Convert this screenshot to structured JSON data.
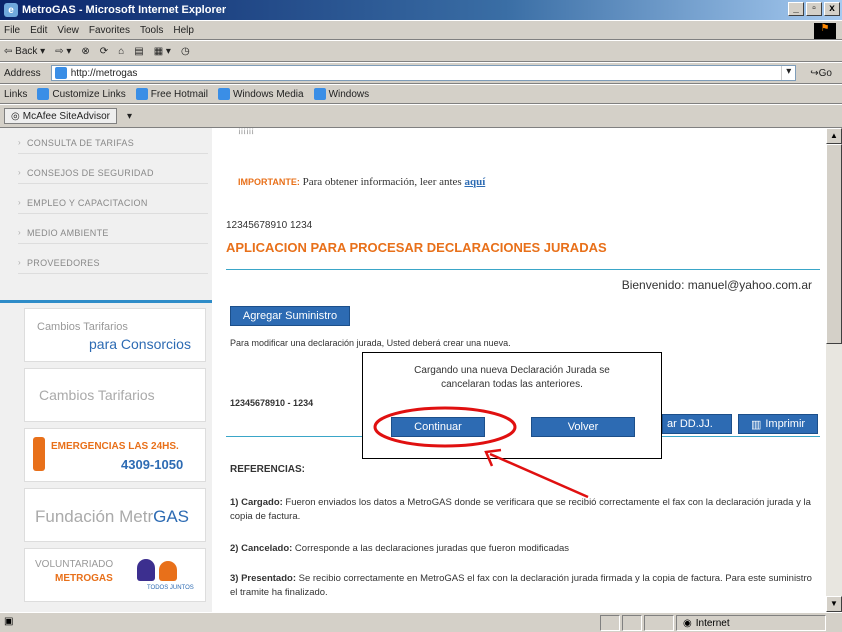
{
  "window": {
    "title": "MetroGAS - Microsoft Internet Explorer",
    "controls": [
      "_",
      "▫",
      "x"
    ]
  },
  "menubar": [
    "File",
    "Edit",
    "View",
    "Favorites",
    "Tools",
    "Help"
  ],
  "toolbar": {
    "back": "Back",
    "icons": [
      "forward-icon",
      "stop-icon",
      "refresh-icon",
      "home-icon",
      "print-icon",
      "edit-icon",
      "history-icon"
    ]
  },
  "address": {
    "label": "Address",
    "value": "http://metrogas",
    "go": "Go"
  },
  "links": {
    "label": "Links",
    "items": [
      "Customize Links",
      "Free Hotmail",
      "Windows Media",
      "Windows"
    ]
  },
  "mcafee": {
    "label": "McAfee SiteAdvisor"
  },
  "sidebar": {
    "items": [
      "CONSULTA DE TARIFAS",
      "CONSEJOS DE SEGURIDAD",
      "EMPLEO Y CAPACITACION",
      "MEDIO AMBIENTE",
      "PROVEEDORES"
    ],
    "promos": {
      "cambios_consorcios": {
        "line1": "Cambios Tarifarios",
        "line2": "para Consorcios"
      },
      "cambios": "Cambios Tarifarios",
      "emergencias": {
        "line1": "EMERGENCIAS LAS 24HS.",
        "line2": "4309-1050"
      },
      "fundacion": {
        "part1": "Fundación Metr",
        "part2": "GAS"
      },
      "voluntariado": {
        "line1": "VOLUNTARIADO",
        "line2": "METROGAS",
        "line3": "TODOS JUNTOS"
      }
    }
  },
  "content": {
    "top_partial": "¡¡¡¡¡¡",
    "importante_label": "IMPORTANTE:",
    "importante_text": " Para obtener información, leer antes ",
    "importante_link": "aquí",
    "code_line": "12345678910 1234",
    "heading": "APLICACION PARA PROCESAR DECLARACIONES JURADAS",
    "welcome_label": "Bienvenido:",
    "welcome_email": "manuel@yahoo.com.ar",
    "add_button": "Agregar Suministro",
    "modify_note": "Para modificar una declaración jurada, Usted deberá crear una nueva.",
    "supply_code": "12345678910 - 1234",
    "ddjj_button": "ar DD.JJ.",
    "print_button": "Imprimir",
    "referencias_title": "REFERENCIAS:",
    "refs": [
      {
        "term": "1) Cargado:",
        "text": " Fueron enviados los datos a MetroGAS donde se verificara que se recibió correctamente el fax con la declaración jurada y la copia de factura."
      },
      {
        "term": "2) Cancelado:",
        "text": " Corresponde a las declaraciones juradas que fueron modificadas"
      },
      {
        "term": "3) Presentado:",
        "text": " Se recibio correctamente en MetroGAS el fax con la declaración jurada firmada y la copia de factura. Para este suministro el tramite ha finalizado."
      }
    ]
  },
  "dialog": {
    "line1": "Cargando una nueva Declaración Jurada se",
    "line2": "cancelaran todas las anteriores.",
    "continue": "Continuar",
    "back": "Volver"
  },
  "annotation": {
    "color": "#e01010"
  },
  "statusbar": {
    "zone": "Internet"
  },
  "colors": {
    "accent_orange": "#e8701a",
    "button_blue": "#2d6bb3",
    "teal_line": "#3aa6c8"
  }
}
